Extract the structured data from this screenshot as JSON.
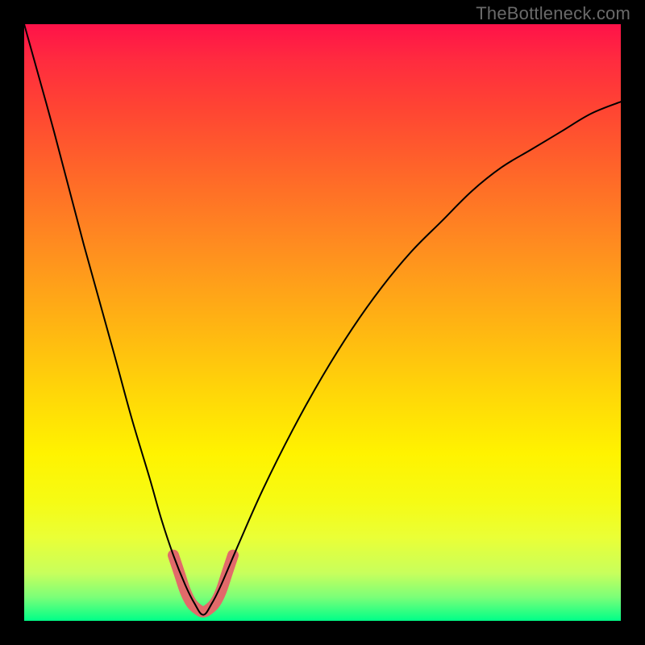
{
  "watermark": "TheBottleneck.com",
  "chart_data": {
    "type": "line",
    "title": "",
    "xlabel": "",
    "ylabel": "",
    "xlim": [
      0,
      100
    ],
    "ylim": [
      0,
      100
    ],
    "grid": false,
    "series": [
      {
        "name": "black-curve",
        "color": "#000000",
        "stroke_width": 2,
        "x": [
          0,
          5,
          10,
          15,
          18,
          21,
          23,
          25,
          27,
          28.5,
          30,
          31.5,
          33,
          36,
          40,
          45,
          50,
          55,
          60,
          65,
          70,
          75,
          80,
          85,
          90,
          95,
          100
        ],
        "y": [
          100,
          82,
          63,
          45,
          34,
          24,
          17,
          11,
          6,
          3,
          1,
          3,
          6,
          13,
          22,
          32,
          41,
          49,
          56,
          62,
          67,
          72,
          76,
          79,
          82,
          85,
          87
        ]
      },
      {
        "name": "pink-highlight",
        "color": "#e26a6a",
        "stroke_width": 14,
        "x": [
          25,
          26,
          27,
          28,
          29,
          30,
          31,
          32,
          33,
          34,
          35
        ],
        "y": [
          11,
          8,
          5,
          3,
          2,
          1.5,
          2,
          3,
          5,
          8,
          11
        ]
      }
    ]
  }
}
